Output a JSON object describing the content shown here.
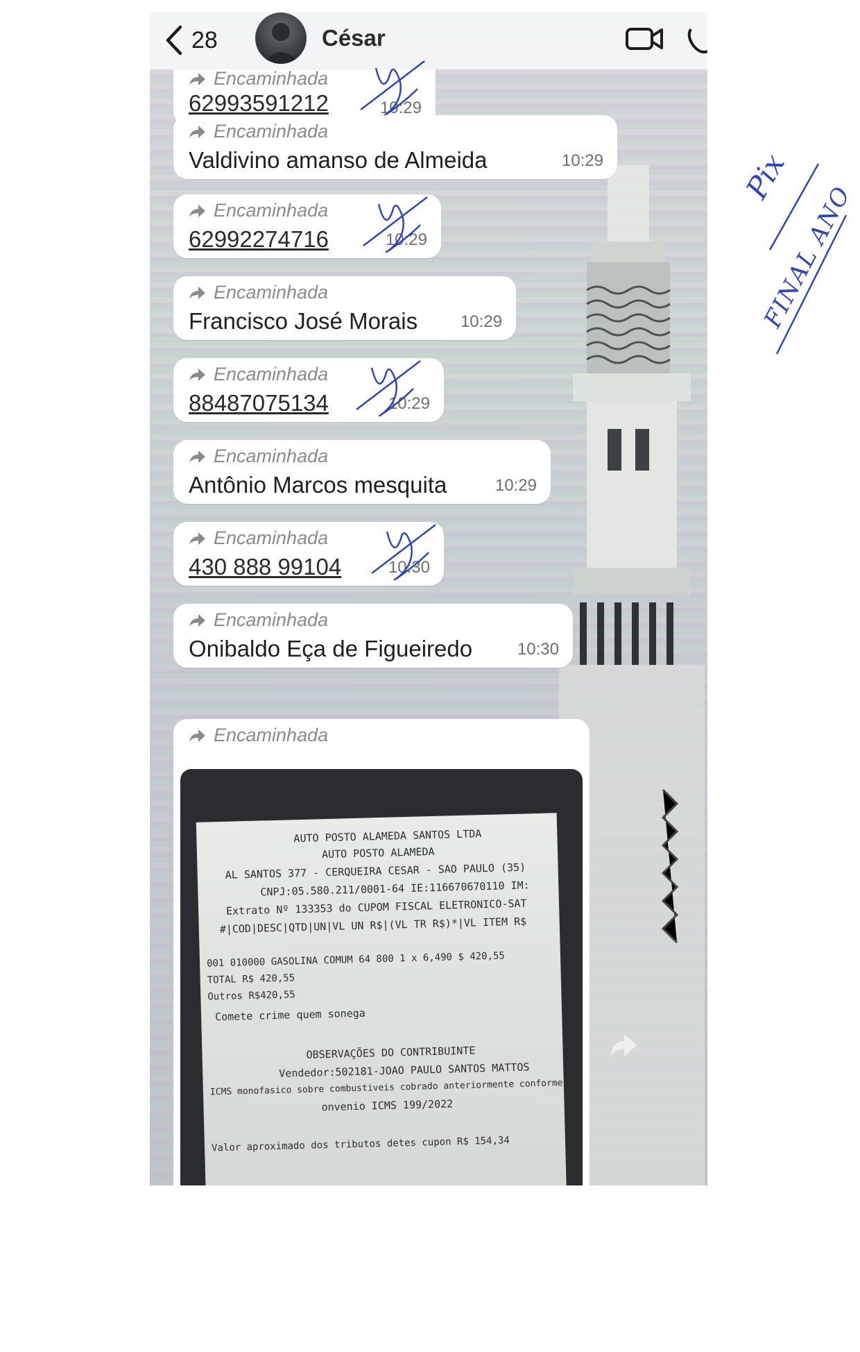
{
  "header": {
    "back_count": "28",
    "contact_name": "César"
  },
  "messages": [
    {
      "forwarded_label": "Encaminhada",
      "text": "62993591212",
      "time": "10:29",
      "is_phone": true,
      "signed": true
    },
    {
      "forwarded_label": "Encaminhada",
      "text": "Valdivino amanso de Almeida",
      "time": "10:29",
      "is_phone": false,
      "signed": false
    },
    {
      "forwarded_label": "Encaminhada",
      "text": "62992274716",
      "time": "10:29",
      "is_phone": true,
      "signed": true
    },
    {
      "forwarded_label": "Encaminhada",
      "text": "Francisco José Morais",
      "time": "10:29",
      "is_phone": false,
      "signed": false
    },
    {
      "forwarded_label": "Encaminhada",
      "text": "88487075134",
      "time": "10:29",
      "is_phone": true,
      "signed": true
    },
    {
      "forwarded_label": "Encaminhada",
      "text": "Antônio Marcos mesquita",
      "time": "10:29",
      "is_phone": false,
      "signed": false
    },
    {
      "forwarded_label": "Encaminhada",
      "text": "430 888 99104",
      "time": "10:30",
      "is_phone": true,
      "signed": true
    },
    {
      "forwarded_label": "Encaminhada",
      "text": "Onibaldo Eça de Figueiredo",
      "time": "10:30",
      "is_phone": false,
      "signed": false
    }
  ],
  "image_message": {
    "forwarded_label": "Encaminhada",
    "receipt": {
      "lines": [
        "AUTO POSTO ALAMEDA SANTOS LTDA",
        "AUTO POSTO ALAMEDA",
        "AL SANTOS 377 - CERQUEIRA CESAR - SAO PAULO (35)",
        "CNPJ:05.580.211/0001-64 IE:116670670110 IM:",
        "Extrato Nº 133353 do CUPOM FISCAL ELETRONICO-SAT",
        "#|COD|DESC|QTD|UN|VL UN R$|(VL TR R$)*|VL ITEM R$",
        "001 010000 GASOLINA COMUM       64 800 1 x 6,490  $ 420,55",
        "TOTAL R$                                         420,55",
        "Outros                                         R$420,55",
        "Comete crime quem sonega",
        "OBSERVAÇÕES DO CONTRIBUINTE",
        "Vendedor:502181-JOAO PAULO SANTOS MATTOS",
        "ICMS monofasico sobre combustiveis cobrado anteriormente conforme C",
        "onvenio ICMS 199/2022",
        "Valor aproximado dos tributos detes cupon            R$ 154,34"
      ]
    }
  },
  "handwriting": {
    "line1": "Pix",
    "line2": "FINAL ANO"
  },
  "colors": {
    "bubble": "#ffffff",
    "ink_blue": "#2f45b8",
    "header_bg": "#f5f5f7"
  },
  "icons": {
    "back": "chevron-left-icon",
    "video": "video-camera-icon",
    "call": "phone-icon",
    "forward": "forward-arrow-icon",
    "share": "share-arrow-icon"
  }
}
